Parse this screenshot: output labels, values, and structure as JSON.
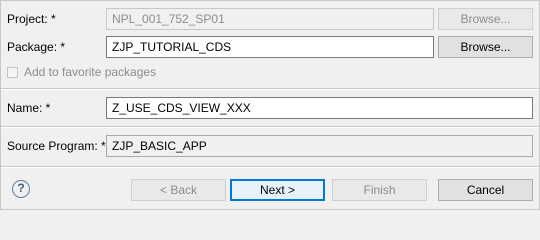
{
  "form": {
    "project": {
      "label": "Project: *",
      "value": "NPL_001_752_SP01",
      "browse_label": "Browse..."
    },
    "package": {
      "label": "Package: *",
      "value": "ZJP_TUTORIAL_CDS",
      "browse_label": "Browse..."
    },
    "add_favorite": {
      "label": "Add to favorite packages",
      "checked": false
    },
    "name": {
      "label": "Name: *",
      "value": "Z_USE_CDS_VIEW_XXX"
    },
    "source_program": {
      "label": "Source Program: *",
      "value": "ZJP_BASIC_APP"
    }
  },
  "footer": {
    "help_glyph": "?",
    "back_label": "< Back",
    "next_label": "Next >",
    "finish_label": "Finish",
    "cancel_label": "Cancel"
  },
  "icons": {
    "help": "help-question-icon",
    "checkbox": "checkbox-unchecked"
  },
  "colors": {
    "default_button_border": "#0078d7",
    "help_icon": "#5a7fa6",
    "disabled_text": "#8c8c8c"
  }
}
